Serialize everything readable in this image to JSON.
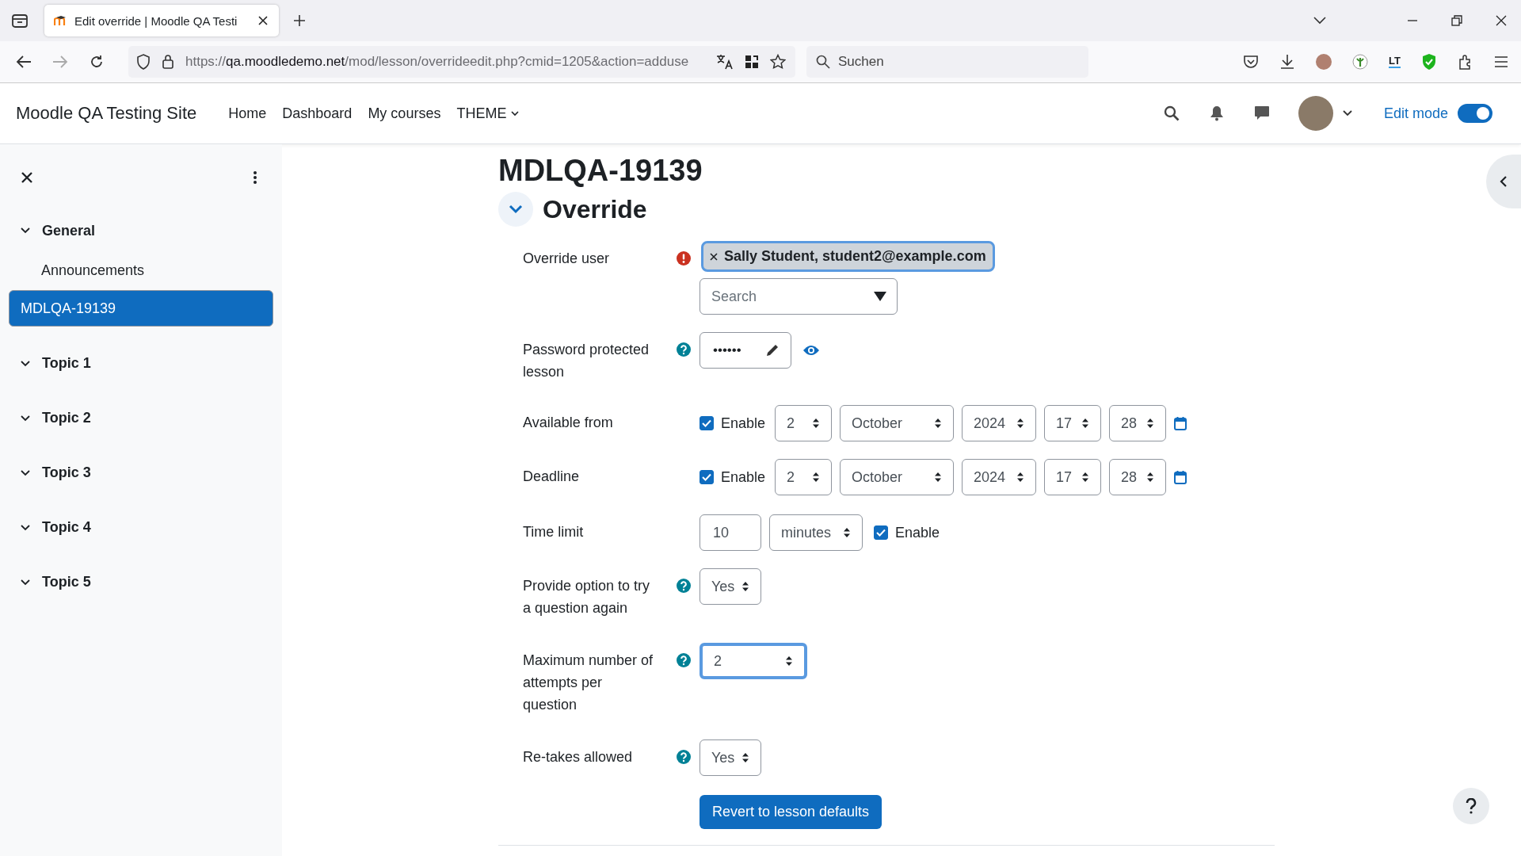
{
  "browser": {
    "tab_title": "Edit override | Moodle QA Testi",
    "url_scheme": "https://",
    "url_host": "qa.moodledemo.net",
    "url_path": "/mod/lesson/overrideedit.php?cmid=1205&action=adduse",
    "search_placeholder": "Suchen",
    "lt_icon": "LT"
  },
  "header": {
    "site_name": "Moodle QA Testing Site",
    "nav": [
      {
        "label": "Home"
      },
      {
        "label": "Dashboard"
      },
      {
        "label": "My courses"
      },
      {
        "label": "THEME",
        "dropdown": true
      }
    ],
    "edit_mode": {
      "label": "Edit mode",
      "on": true
    }
  },
  "sidebar": {
    "sections": [
      {
        "label": "General",
        "expanded": true,
        "children": [
          {
            "label": "Announcements",
            "selected": false
          },
          {
            "label": "MDLQA-19139",
            "selected": true
          }
        ]
      },
      {
        "label": "Topic 1",
        "expanded": true
      },
      {
        "label": "Topic 2",
        "expanded": true
      },
      {
        "label": "Topic 3",
        "expanded": true
      },
      {
        "label": "Topic 4",
        "expanded": true
      },
      {
        "label": "Topic 5",
        "expanded": true
      }
    ]
  },
  "page": {
    "title": "MDLQA-19139",
    "section": {
      "label": "Override",
      "expanded": true
    },
    "fields": [
      {
        "kind": "autocomplete",
        "label": "Override user",
        "required": true,
        "selection": "Sally Student, student2@example.com",
        "placeholder": "Search"
      },
      {
        "kind": "password",
        "label": "Password protected lesson",
        "help": true,
        "value": "••••••"
      },
      {
        "kind": "datetime",
        "label": "Available from",
        "enabled": true,
        "enable_label": "Enable",
        "parts": [
          "2",
          "October",
          "2024",
          "17",
          "28"
        ]
      },
      {
        "kind": "datetime",
        "label": "Deadline",
        "enabled": true,
        "enable_label": "Enable",
        "parts": [
          "2",
          "October",
          "2024",
          "17",
          "28"
        ]
      },
      {
        "kind": "duration",
        "label": "Time limit",
        "value": "10",
        "unit": "minutes",
        "enabled": true,
        "enable_label": "Enable"
      },
      {
        "kind": "select",
        "label": "Provide option to try a question again",
        "help": true,
        "value": "Yes",
        "focused": false
      },
      {
        "kind": "select",
        "label": "Maximum number of attempts per question",
        "help": true,
        "value": "2",
        "focused": true
      },
      {
        "kind": "select",
        "label": "Re-takes allowed",
        "help": true,
        "value": "Yes",
        "focused": false
      }
    ],
    "button": "Revert to lesson defaults"
  }
}
